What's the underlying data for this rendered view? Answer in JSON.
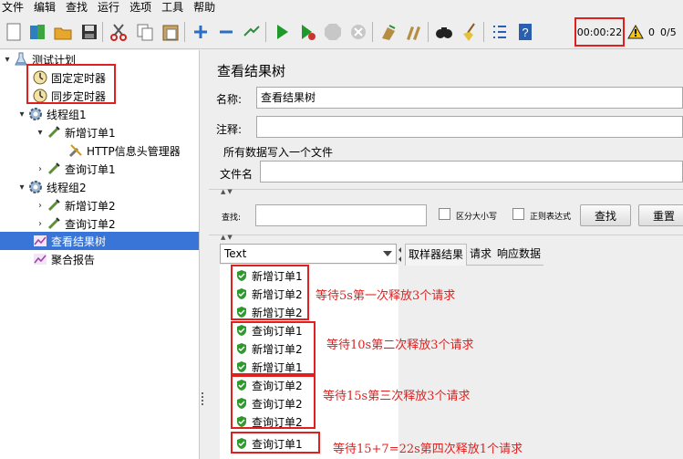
{
  "menu": [
    "文件",
    "编辑",
    "查找",
    "运行",
    "选项",
    "工具",
    "帮助"
  ],
  "toolbar": {
    "timer": "00:00:22",
    "warning_count": "0",
    "threads": "0/5"
  },
  "tree": {
    "root": "测试计划",
    "timer_constant": "固定定时器",
    "timer_sync": "同步定时器",
    "group1": "线程组1",
    "g1_add": "新增订单1",
    "g1_header": "HTTP信息头管理器",
    "g1_query": "查询订单1",
    "group2": "线程组2",
    "g2_add": "新增订单2",
    "g2_query": "查询订单2",
    "result_tree": "查看结果树",
    "aggregate": "聚合报告"
  },
  "panel": {
    "title": "查看结果树",
    "name_label": "名称:",
    "name_value": "查看结果树",
    "comment_label": "注释:",
    "file_group": "所有数据写入一个文件",
    "file_label": "文件名",
    "search_label": "查找:",
    "case_label": "区分大小写",
    "regex_label": "正则表达式",
    "find_btn": "查找",
    "reset_btn": "重置",
    "renderer": "Text",
    "tabs": [
      "取样器结果",
      "请求",
      "响应数据"
    ]
  },
  "results": [
    "新增订单1",
    "新增订单2",
    "新增订单2",
    "查询订单1",
    "新增订单2",
    "新增订单1",
    "查询订单2",
    "查询订单2",
    "查询订单2",
    "查询订单1"
  ],
  "notes": [
    "等待5s第一次释放3个请求",
    "等待10s第二次释放3个请求",
    "等待15s第三次释放3个请求",
    "等待15+7=22s第四次释放1个请求"
  ],
  "colors": {
    "highlight": "#e0201f",
    "selection": "#3875d7",
    "success": "#2e9a2e"
  }
}
